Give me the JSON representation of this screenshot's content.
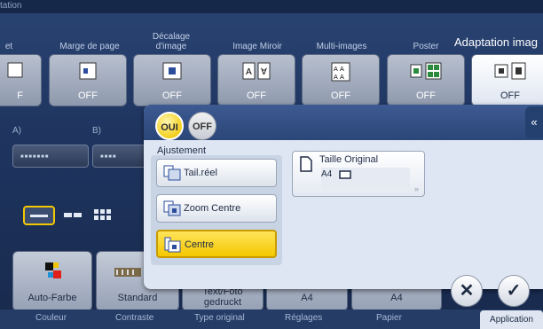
{
  "header": {
    "title": "tation"
  },
  "tabs": [
    {
      "label": "et",
      "value": "F"
    },
    {
      "label": "Marge de page",
      "value": "OFF"
    },
    {
      "label": "Décalage d'image",
      "value": "OFF"
    },
    {
      "label": "Image Miroir",
      "value": "OFF"
    },
    {
      "label": "Multi-images",
      "value": "OFF"
    },
    {
      "label": "Poster",
      "value": "OFF"
    },
    {
      "label": "Adaptation imag",
      "value": "OFF"
    }
  ],
  "left_labels": {
    "a": "A)",
    "b": "B)"
  },
  "overlay": {
    "toggle_on": "OUI",
    "toggle_off": "OFF",
    "section_label": "Ajustement",
    "options": [
      "Tail.réel",
      "Zoom Centre",
      "Centre"
    ],
    "selected_option": "Centre",
    "original_title": "Taille Original",
    "original_value": "A4",
    "back_glyph": "«",
    "cancel_glyph": "✕",
    "ok_glyph": "✓"
  },
  "bottom_tiles": [
    {
      "value": "Auto-Farbe"
    },
    {
      "value": "Standard"
    },
    {
      "value": "Text/Foto gedruckt"
    },
    {
      "value": "A4"
    },
    {
      "value": "A4"
    }
  ],
  "bottom_tabs": [
    "Couleur",
    "Contraste",
    "Type original",
    "Réglages",
    "Papier"
  ],
  "application_tab": "Application",
  "colors": {
    "accent_yellow": "#f4c800",
    "header_blue": "#2b4677"
  }
}
